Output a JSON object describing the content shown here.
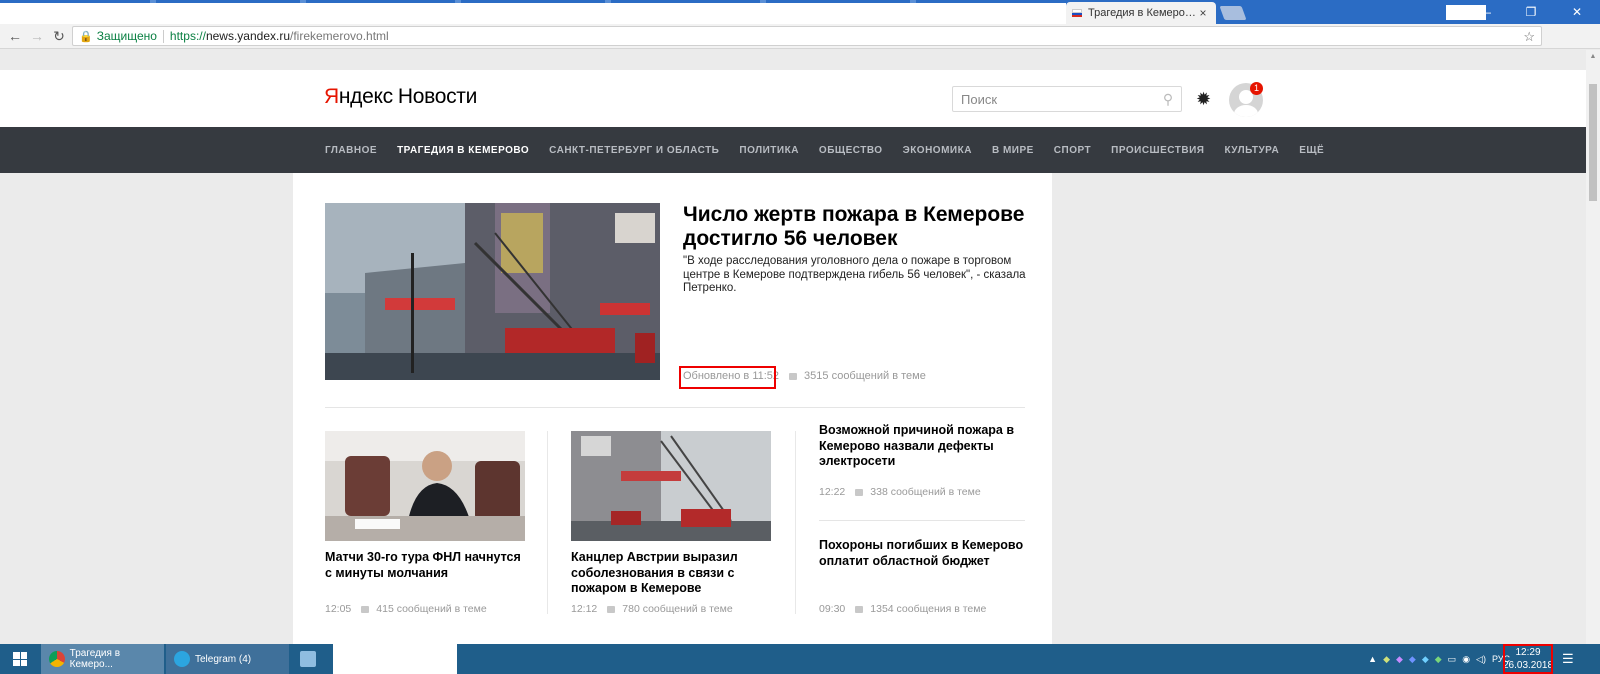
{
  "browser": {
    "tab_title": "Трагедия в Кемерово —",
    "tab_close": "×",
    "win_min": "—",
    "win_restore": "❐",
    "win_close": "✕",
    "back": "←",
    "forward": "→",
    "reload": "↻",
    "lock": "🔒",
    "secure_label": "Защищено",
    "url_proto": "https://",
    "url_host": "news.yandex.ru",
    "url_path": "/firekemerovo.html",
    "star": "☆",
    "shield": "⛊",
    "menu": "⋮"
  },
  "header": {
    "logo_y": "Я",
    "logo_rest": "ндекс",
    "logo_news": "Новости",
    "search_placeholder": "Поиск",
    "search_icon": "⚲",
    "gear": "✹",
    "badge": "1"
  },
  "rubrics": [
    {
      "label": "ГЛАВНОЕ"
    },
    {
      "label": "ТРАГЕДИЯ В КЕМЕРОВО"
    },
    {
      "label": "САНКТ-ПЕТЕРБУРГ И ОБЛАСТЬ"
    },
    {
      "label": "ПОЛИТИКА"
    },
    {
      "label": "ОБЩЕСТВО"
    },
    {
      "label": "ЭКОНОМИКА"
    },
    {
      "label": "В МИРЕ"
    },
    {
      "label": "СПОРТ"
    },
    {
      "label": "ПРОИСШЕСТВИЯ"
    },
    {
      "label": "КУЛЬТУРА"
    },
    {
      "label": "ЕЩЁ"
    }
  ],
  "lead": {
    "title": "Число жертв пожара в Кемерове достигло 56 человек",
    "text": "\"В ходе расследования уголовного дела о пожаре в торговом центре в Кемерове подтверждена гибель 56 человек\", - сказала Петренко.",
    "updated": "Обновлено в 11:52",
    "messages": "3515 сообщений в теме"
  },
  "cards": [
    {
      "title": "Матчи 30-го тура ФНЛ начнутся с минуты молчания",
      "time": "12:05",
      "messages": "415 сообщений в теме"
    },
    {
      "title": "Канцлер Австрии выразил соболезнования в связи с пожаром в Кемерове",
      "time": "12:12",
      "messages": "780 сообщений в теме"
    },
    {
      "title": "Возможной причиной пожара в Кемерово назвали дефекты электросети",
      "time": "12:22",
      "messages": "338 сообщений в теме"
    },
    {
      "title": "Похороны погибших в Кемерово оплатит областной бюджет",
      "time": "09:30",
      "messages": "1354 сообщения в теме"
    }
  ],
  "taskbar": {
    "chrome_item": "Трагедия в Кемеро...",
    "telegram_item": "Telegram (4)",
    "tray_up": "▲",
    "lang": "РУС",
    "time": "12:29",
    "date": "26.03.2018",
    "notif": "☰"
  }
}
